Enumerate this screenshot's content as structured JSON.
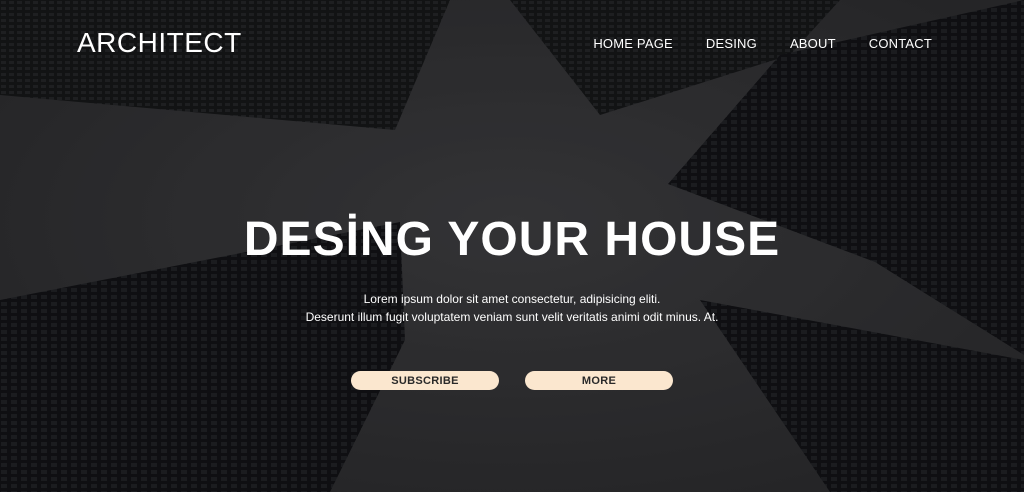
{
  "brand": {
    "logo": "ARCHITECT"
  },
  "nav": {
    "items": [
      "HOME PAGE",
      "DESING",
      "ABOUT",
      "CONTACT"
    ]
  },
  "hero": {
    "headline": "DESİNG YOUR HOUSE",
    "subtext_line1": "Lorem ipsum dolor sit amet consectetur, adipisicing eliti.",
    "subtext_line2": "Deserunt illum fugit voluptatem veniam sunt velit veritatis animi odit minus. At.",
    "primary_button": "SUBSCRIBE",
    "secondary_button": "MORE"
  },
  "colors": {
    "button_bg": "#fbe7cf",
    "overlay": "#2b2b2d",
    "text": "#ffffff"
  }
}
